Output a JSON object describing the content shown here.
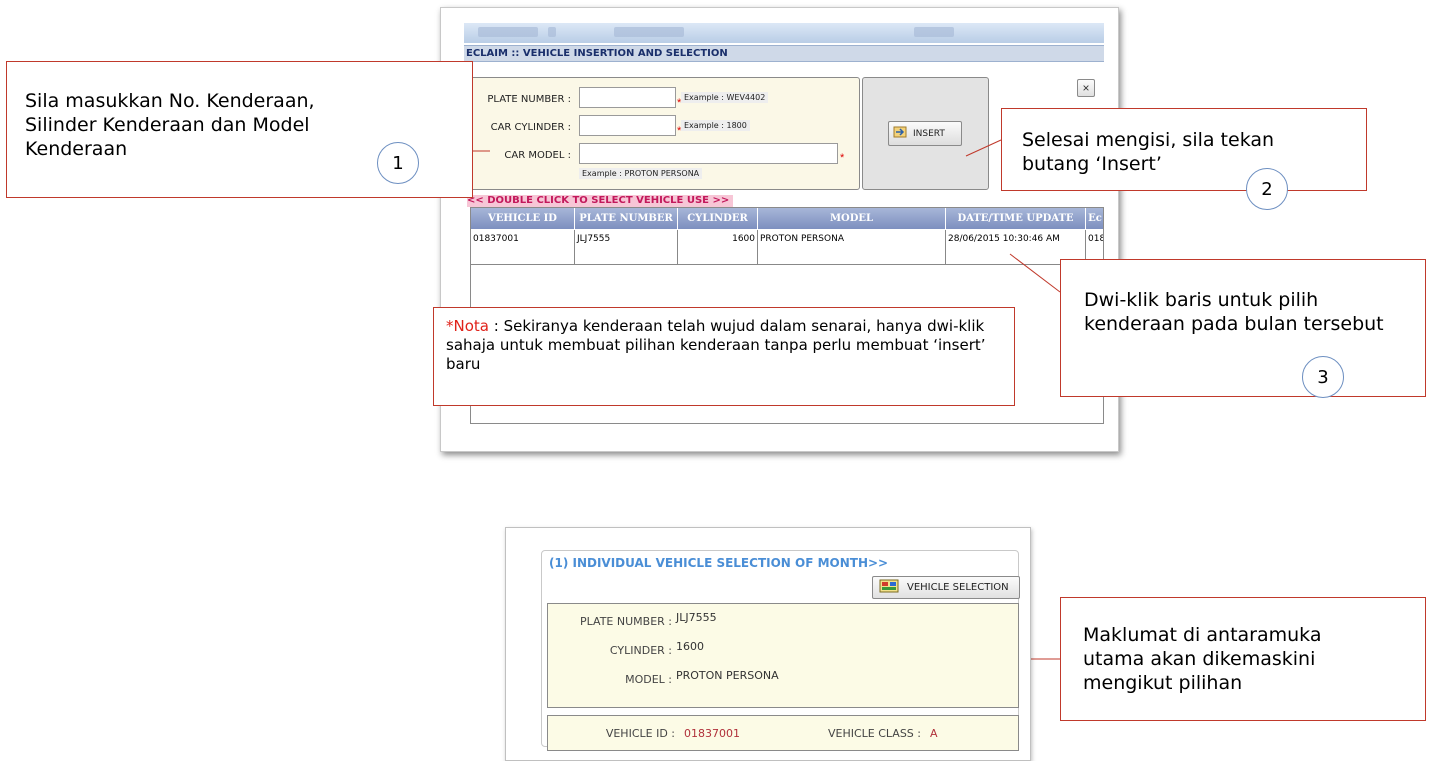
{
  "dialog": {
    "title": "ECLAIM :: VEHICLE INSERTION AND SELECTION",
    "close_label": "×",
    "fields": {
      "plate_label": "PLATE NUMBER :",
      "plate_example": "Example : WEV4402",
      "cylinder_label": "CAR CYLINDER :",
      "cylinder_example": "Example : 1800",
      "model_label": "CAR MODEL :",
      "model_example": "Example : PROTON PERSONA",
      "required_mark": "*"
    },
    "insert_label": "INSERT",
    "double_click_hint": "<< DOUBLE CLICK TO SELECT VEHICLE USE >>",
    "grid": {
      "columns": [
        "VEHICLE ID",
        "PLATE NUMBER",
        "CYLINDER",
        "MODEL",
        "DATE/TIME UPDATE",
        "Ec"
      ],
      "rows": [
        {
          "vehicle_id": "01837001",
          "plate": "JLJ7555",
          "cylinder": "1600",
          "model": "PROTON PERSONA",
          "updated": "28/06/2015 10:30:46 AM",
          "extra": "018"
        }
      ]
    }
  },
  "callouts": {
    "c1": {
      "text": "Sila masukkan No. Kenderaan, Silinder Kenderaan dan Model Kenderaan",
      "num": "1"
    },
    "c2": {
      "text": "Selesai mengisi, sila tekan butang ‘Insert’",
      "num": "2"
    },
    "c3": {
      "text": "Dwi-klik baris untuk pilih kenderaan pada bulan tersebut",
      "num": "3"
    },
    "note": {
      "prefix": "*Nota",
      "text": " : Sekiranya kenderaan telah wujud dalam senarai, hanya dwi-klik sahaja untuk membuat pilihan kenderaan tanpa perlu membuat ‘insert’ baru"
    },
    "c4": {
      "text": "Maklumat di antaramuka utama akan dikemaskini mengikut pilihan"
    }
  },
  "selection": {
    "legend": "(1) INDIVIDUAL VEHICLE SELECTION OF MONTH>>",
    "button_label": "VEHICLE SELECTION",
    "plate_label": "PLATE NUMBER :",
    "plate_value": "JLJ7555",
    "cylinder_label": "CYLINDER :",
    "cylinder_value": "1600",
    "model_label": "MODEL :",
    "model_value": "PROTON PERSONA",
    "vehicle_id_label": "VEHICLE ID :",
    "vehicle_id_value": "01837001",
    "vehicle_class_label": "VEHICLE CLASS :",
    "vehicle_class_value": "A"
  },
  "colors": {
    "callout_border": "#c0392b",
    "grid_header": "#7d8fbf",
    "hint_pink": "#c2185b",
    "legend_blue": "#4a8ed6"
  },
  "icons": {
    "insert": "insert-icon",
    "vehicle_selection": "car-select-icon",
    "close": "close-icon"
  }
}
